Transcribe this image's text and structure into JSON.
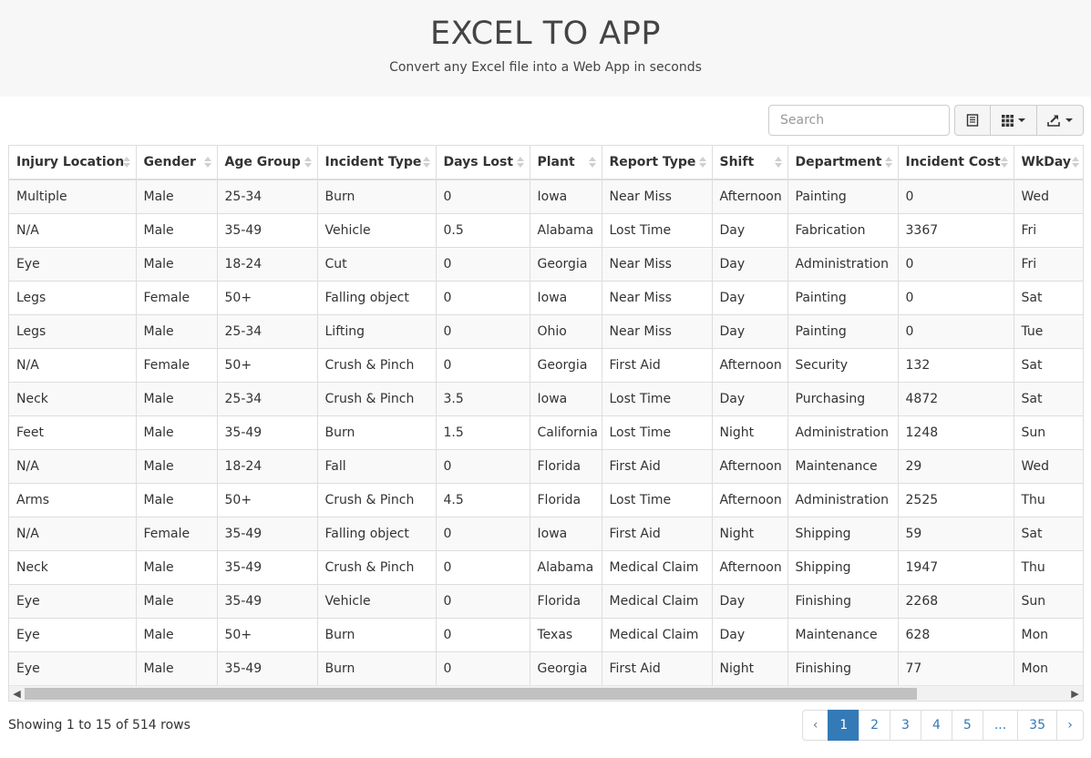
{
  "header": {
    "title": "EXCEL TO APP",
    "subtitle": "Convert any Excel file into a Web App in seconds"
  },
  "toolbar": {
    "search_placeholder": "Search",
    "buttons": [
      {
        "name": "toggle-view",
        "icon": "list-icon"
      },
      {
        "name": "columns",
        "icon": "grid-icon"
      },
      {
        "name": "export",
        "icon": "export-icon"
      }
    ]
  },
  "table": {
    "columns": [
      "Injury Location",
      "Gender",
      "Age Group",
      "Incident Type",
      "Days Lost",
      "Plant",
      "Report Type",
      "Shift",
      "Department",
      "Incident Cost",
      "WkDay"
    ],
    "rows": [
      [
        "Multiple",
        "Male",
        "25-34",
        "Burn",
        "0",
        "Iowa",
        "Near Miss",
        "Afternoon",
        "Painting",
        "0",
        "Wed"
      ],
      [
        "N/A",
        "Male",
        "35-49",
        "Vehicle",
        "0.5",
        "Alabama",
        "Lost Time",
        "Day",
        "Fabrication",
        "3367",
        "Fri"
      ],
      [
        "Eye",
        "Male",
        "18-24",
        "Cut",
        "0",
        "Georgia",
        "Near Miss",
        "Day",
        "Administration",
        "0",
        "Fri"
      ],
      [
        "Legs",
        "Female",
        "50+",
        "Falling object",
        "0",
        "Iowa",
        "Near Miss",
        "Day",
        "Painting",
        "0",
        "Sat"
      ],
      [
        "Legs",
        "Male",
        "25-34",
        "Lifting",
        "0",
        "Ohio",
        "Near Miss",
        "Day",
        "Painting",
        "0",
        "Tue"
      ],
      [
        "N/A",
        "Female",
        "50+",
        "Crush & Pinch",
        "0",
        "Georgia",
        "First Aid",
        "Afternoon",
        "Security",
        "132",
        "Sat"
      ],
      [
        "Neck",
        "Male",
        "25-34",
        "Crush & Pinch",
        "3.5",
        "Iowa",
        "Lost Time",
        "Day",
        "Purchasing",
        "4872",
        "Sat"
      ],
      [
        "Feet",
        "Male",
        "35-49",
        "Burn",
        "1.5",
        "California",
        "Lost Time",
        "Night",
        "Administration",
        "1248",
        "Sun"
      ],
      [
        "N/A",
        "Male",
        "18-24",
        "Fall",
        "0",
        "Florida",
        "First Aid",
        "Afternoon",
        "Maintenance",
        "29",
        "Wed"
      ],
      [
        "Arms",
        "Male",
        "50+",
        "Crush & Pinch",
        "4.5",
        "Florida",
        "Lost Time",
        "Afternoon",
        "Administration",
        "2525",
        "Thu"
      ],
      [
        "N/A",
        "Female",
        "35-49",
        "Falling object",
        "0",
        "Iowa",
        "First Aid",
        "Night",
        "Shipping",
        "59",
        "Sat"
      ],
      [
        "Neck",
        "Male",
        "35-49",
        "Crush & Pinch",
        "0",
        "Alabama",
        "Medical Claim",
        "Afternoon",
        "Shipping",
        "1947",
        "Thu"
      ],
      [
        "Eye",
        "Male",
        "35-49",
        "Vehicle",
        "0",
        "Florida",
        "Medical Claim",
        "Day",
        "Finishing",
        "2268",
        "Sun"
      ],
      [
        "Eye",
        "Male",
        "50+",
        "Burn",
        "0",
        "Texas",
        "Medical Claim",
        "Day",
        "Maintenance",
        "628",
        "Mon"
      ],
      [
        "Eye",
        "Male",
        "35-49",
        "Burn",
        "0",
        "Georgia",
        "First Aid",
        "Night",
        "Finishing",
        "77",
        "Mon"
      ]
    ]
  },
  "footer": {
    "status": "Showing 1 to 15 of 514 rows",
    "pages": [
      "‹",
      "1",
      "2",
      "3",
      "4",
      "5",
      "...",
      "35",
      "›"
    ],
    "active_page": "1"
  },
  "colors": {
    "accent": "#337ab7",
    "header_bg": "#f7f7f7",
    "stripe": "#f9f9f9"
  }
}
